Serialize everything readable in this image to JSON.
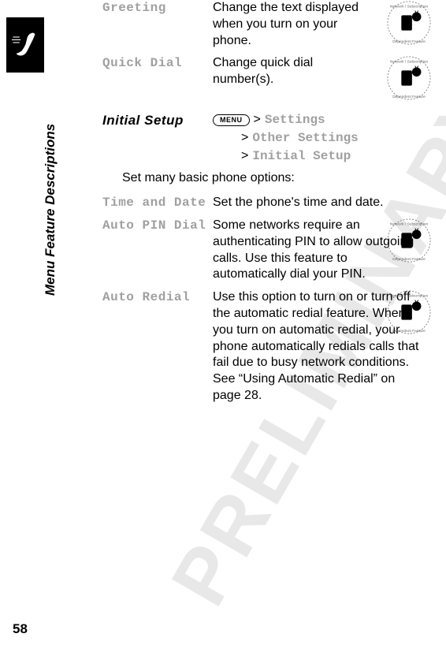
{
  "section_title": "Menu Feature Descriptions",
  "page_number": "58",
  "watermark": "PRELIMINARY",
  "rows": {
    "greeting": {
      "label": "Greeting",
      "desc": "Change the text displayed when you turn on your phone."
    },
    "quick_dial": {
      "label": "Quick Dial",
      "desc": "Change quick dial number(s)."
    },
    "initial_setup": {
      "label": "Initial Setup",
      "menu_label": "MENU",
      "path1": "Settings",
      "path2": "Other Settings",
      "path3": "Initial Setup",
      "gt": ">"
    },
    "intro": "Set many basic phone options:",
    "time_date": {
      "label": "Time and Date",
      "desc": "Set the phone's time and date."
    },
    "auto_pin": {
      "label": "Auto PIN Dial",
      "desc": "Some networks require an authenticating PIN to allow outgoing calls. Use this feature to automatically dial your PIN."
    },
    "auto_redial": {
      "label": "Auto Redial",
      "desc": "Use this option to turn on or turn off the automatic redial feature. When you turn on automatic redial, your phone automatically redials calls that fail due to busy network conditions. See “Using Automatic Redial” on page 28."
    }
  }
}
